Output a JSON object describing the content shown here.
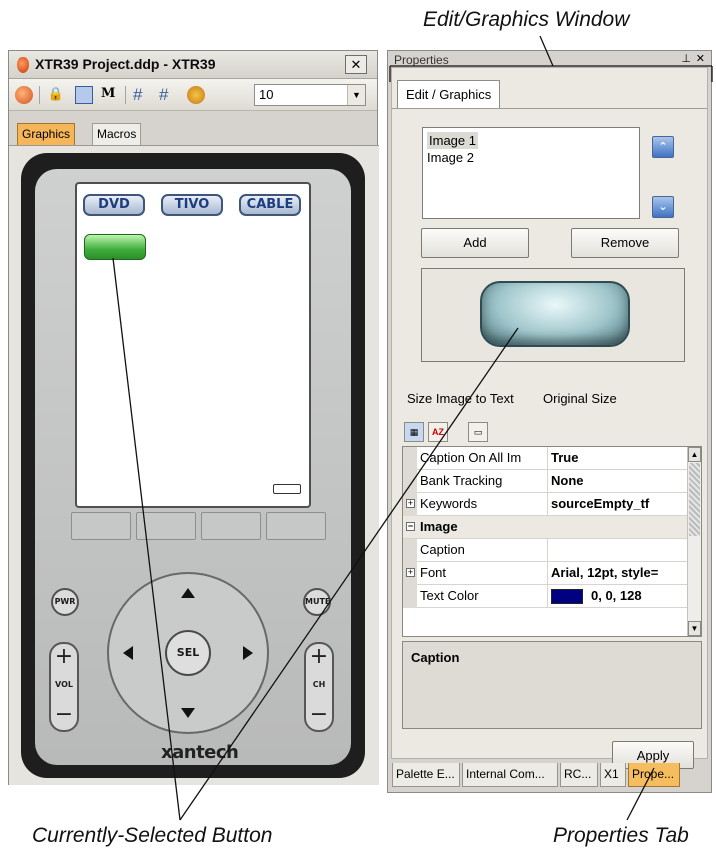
{
  "callouts": {
    "edit_window": "Edit/Graphics Window",
    "selected_button": "Currently-Selected Button",
    "properties_tab": "Properties Tab"
  },
  "left_window": {
    "title": "XTR39 Project.ddp - XTR39",
    "zoom_value": "10",
    "tabs": [
      "Graphics",
      "Macros"
    ],
    "remote": {
      "lcd_buttons": [
        "DVD",
        "TIVO",
        "CABLE"
      ],
      "pwr": "PWR",
      "mute": "MUTE",
      "sel": "SEL",
      "vol": "VOL",
      "ch": "CH",
      "brand": "xantech"
    }
  },
  "right_window": {
    "title": "Properties",
    "tab": "Edit / Graphics",
    "images": [
      "Image 1",
      "Image 2"
    ],
    "add_label": "Add",
    "remove_label": "Remove",
    "size_to_text": "Size Image to Text",
    "original_size": "Original Size",
    "grid": [
      {
        "name": "Caption On All Im",
        "value": "True"
      },
      {
        "name": "Bank Tracking",
        "value": "None"
      },
      {
        "name": "Keywords",
        "value": "sourceEmpty_tf",
        "expand": "+"
      },
      {
        "category": "Image"
      },
      {
        "name": "Caption",
        "value": ""
      },
      {
        "name": "Font",
        "value": "Arial, 12pt, style=",
        "expand": "+"
      },
      {
        "name": "Text Color",
        "value": "0, 0, 128"
      }
    ],
    "description_title": "Caption",
    "apply_label": "Apply",
    "bottom_tabs": [
      "Palette E...",
      "Internal Com...",
      "RC...",
      "X1",
      "Prope..."
    ],
    "colors": {
      "text_color_swatch": "#000080",
      "active_tab": "#f6bd5e"
    }
  }
}
